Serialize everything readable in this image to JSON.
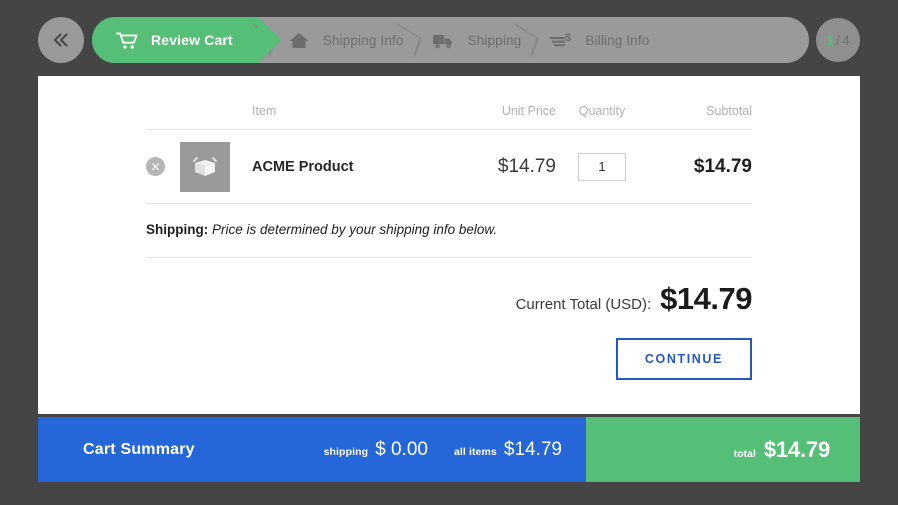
{
  "nav": {
    "back_label": "«",
    "back_icon": "chevron-double-left-icon",
    "steps": [
      {
        "label": "Review Cart",
        "icon": "shopping-cart-icon",
        "active": true
      },
      {
        "label": "Shipping Info",
        "icon": "home-icon",
        "active": false
      },
      {
        "label": "Shipping",
        "icon": "delivery-truck-icon",
        "active": false
      },
      {
        "label": "Billing Info",
        "icon": "invoice-dollar-icon",
        "active": false
      }
    ],
    "current_step": "1",
    "step_separator": "/",
    "total_steps": "4"
  },
  "table": {
    "headers": {
      "item": "Item",
      "unit_price": "Unit Price",
      "quantity": "Quantity",
      "subtotal": "Subtotal"
    },
    "rows": [
      {
        "remove_icon": "remove-circle-icon",
        "thumbnail_icon": "open-box-icon",
        "name": "ACME Product",
        "unit_price": "$14.79",
        "quantity": "1",
        "quantity_placeholder": "1",
        "subtotal": "$14.79"
      }
    ]
  },
  "shipping_note": {
    "label": "Shipping:",
    "text": "Price is determined by your shipping info below."
  },
  "totals": {
    "current_total_label": "Current Total (USD):",
    "current_total_value": "$14.79"
  },
  "actions": {
    "continue_label": "CONTINUE"
  },
  "summary": {
    "title": "Cart Summary",
    "shipping_label": "shipping",
    "shipping_value": "$ 0.00",
    "all_items_label": "all items",
    "all_items_value": "$14.79",
    "total_label": "total",
    "total_value": "$14.79"
  },
  "colors": {
    "background": "#454545",
    "accent_green": "#55be77",
    "accent_blue": "#2566d8",
    "button_blue": "#2457c5",
    "step_track": "#9a9a9a",
    "card": "#ffffff"
  }
}
